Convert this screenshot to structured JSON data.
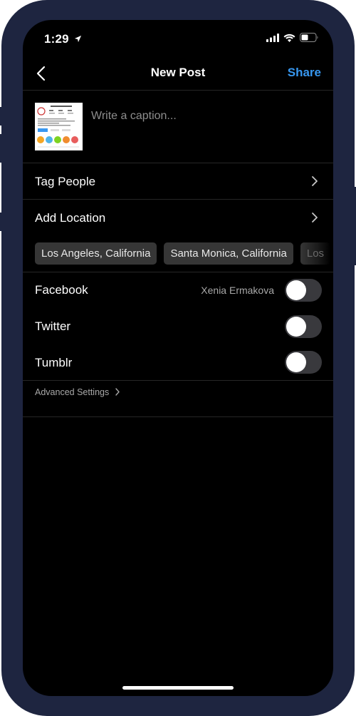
{
  "status_bar": {
    "time": "1:29",
    "location_icon": "location-arrow-icon",
    "signal_icon": "cellular-signal-icon",
    "wifi_icon": "wifi-icon",
    "battery_icon": "battery-icon"
  },
  "nav": {
    "back_icon": "chevron-left-icon",
    "title": "New Post",
    "share_label": "Share",
    "share_color": "#3797f0"
  },
  "post": {
    "caption_placeholder": "Write a caption...",
    "caption_value": ""
  },
  "options": {
    "tag_people": "Tag People",
    "add_location": "Add Location"
  },
  "location_suggestions": [
    "Los Angeles, California",
    "Santa Monica, California",
    "Los"
  ],
  "sharing": [
    {
      "label": "Facebook",
      "account": "Xenia Ermakova",
      "enabled": false
    },
    {
      "label": "Twitter",
      "account": "",
      "enabled": false
    },
    {
      "label": "Tumblr",
      "account": "",
      "enabled": false
    }
  ],
  "advanced_settings": "Advanced Settings",
  "colors": {
    "frame": "#1e2540",
    "background": "#000000",
    "accent": "#3797f0",
    "toggle_off": "#39393d",
    "chip": "#363636"
  }
}
